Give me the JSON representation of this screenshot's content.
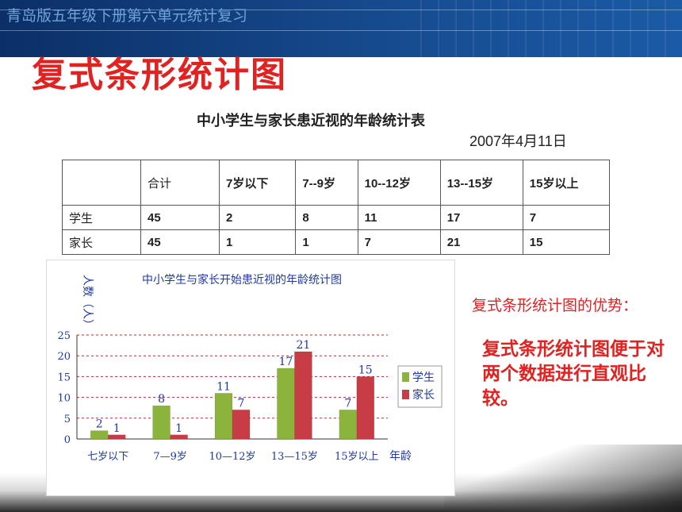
{
  "header": {
    "banner_title": "青岛版五年级下册第六单元统计复习"
  },
  "slide_title": "复式条形统计图",
  "table": {
    "title": "中小学生与家长患近视的年龄统计表",
    "date": "2007年4月11日",
    "columns": [
      "",
      "合计",
      "7岁以下",
      "7--9岁",
      "10--12岁",
      "13--15岁",
      "15岁以上"
    ],
    "rows": [
      {
        "label": "学生",
        "cells": [
          "45",
          "2",
          "8",
          "11",
          "17",
          "7"
        ]
      },
      {
        "label": "家长",
        "cells": [
          "45",
          "1",
          "1",
          "7",
          "21",
          "15"
        ]
      }
    ]
  },
  "chart_data": {
    "type": "bar",
    "title": "中小学生与家长开始患近视的年龄统计图",
    "ylabel": "人数（人）",
    "xlabel": "年龄",
    "categories": [
      "七岁以下",
      "7—9岁",
      "10—12岁",
      "13—15岁",
      "15岁以上"
    ],
    "series": [
      {
        "name": "学生",
        "values": [
          2,
          8,
          11,
          17,
          7
        ],
        "color": "#8cb43c"
      },
      {
        "name": "家长",
        "values": [
          1,
          1,
          7,
          21,
          15
        ],
        "color": "#c83c46"
      }
    ],
    "ylim": [
      0,
      25
    ],
    "yticks": [
      "0",
      "5",
      "10",
      "15",
      "20",
      "25"
    ],
    "grid": true,
    "legend_position": "right"
  },
  "advantage": {
    "title": "复式条形统计图的优势：",
    "body": "复式条形统计图便于对两个数据进行直观比较。"
  },
  "colors": {
    "accent_red": "#e22121",
    "banner_blue": "#164a8e"
  }
}
